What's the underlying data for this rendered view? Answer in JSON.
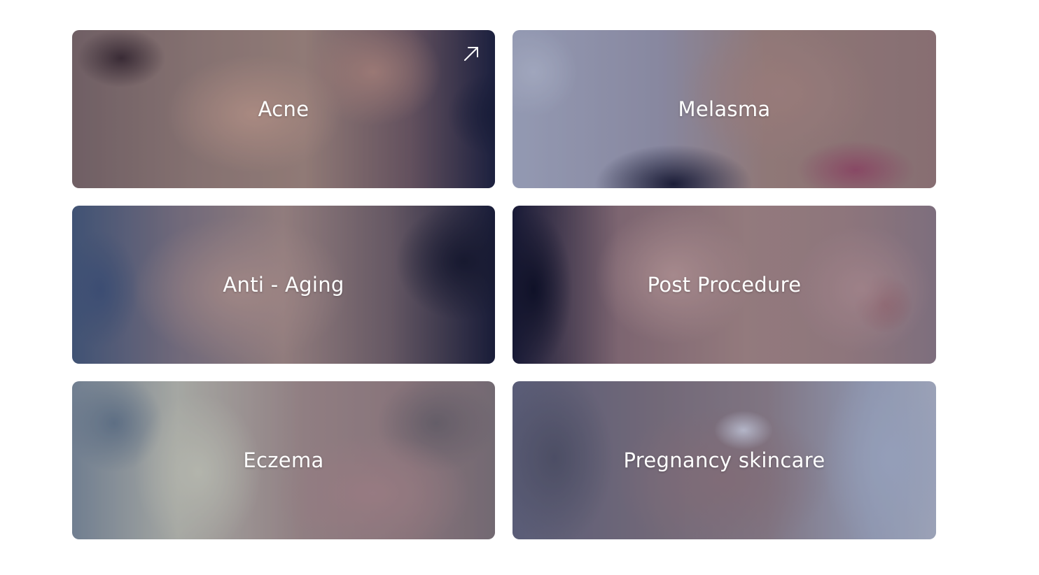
{
  "cards": [
    {
      "label": "Acne",
      "has_arrow": true
    },
    {
      "label": "Melasma"
    },
    {
      "label": "Anti - Aging"
    },
    {
      "label": "Post Procedure"
    },
    {
      "label": "Eczema"
    },
    {
      "label": "Pregnancy skincare"
    }
  ],
  "icons": {
    "card_link": "arrow-up-right-icon"
  },
  "colors": {
    "page_background": "#ffffff",
    "label_text": "#ffffff",
    "overlay_tint": "#141c3c"
  }
}
